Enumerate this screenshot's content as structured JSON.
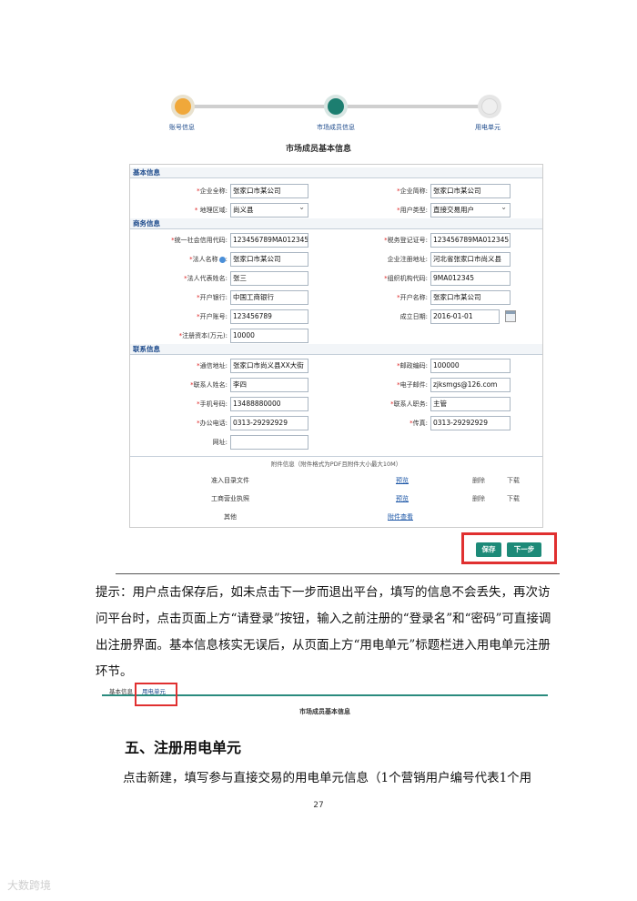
{
  "stepper": {
    "steps": [
      "账号信息",
      "市场成员信息",
      "用电单元"
    ]
  },
  "form": {
    "title": "市场成员基本信息",
    "sections": {
      "basic": "基本信息",
      "business": "商务信息",
      "contact": "联系信息"
    },
    "fields": {
      "company_full_name": {
        "label": "企业全称:",
        "value": "张家口市某公司"
      },
      "company_short_name": {
        "label": "企业简称:",
        "value": "张家口市某公司"
      },
      "region": {
        "label": "地理区域:",
        "value": "尚义县"
      },
      "user_type": {
        "label": "用户类型:",
        "value": "直接交易用户"
      },
      "credit_code": {
        "label": "统一社会信用代码:",
        "value": "123456789MA012345"
      },
      "tax_reg_no": {
        "label": "税务登记证号:",
        "value": "123456789MA012345"
      },
      "legal_name": {
        "label": "法人名称",
        "value": "张家口市某公司"
      },
      "reg_address": {
        "label": "企业注册地址:",
        "value": "河北省张家口市尚义县"
      },
      "legal_rep": {
        "label": "法人代表姓名:",
        "value": "张三"
      },
      "org_code": {
        "label": "组织机构代码:",
        "value": "9MA012345"
      },
      "bank": {
        "label": "开户银行:",
        "value": "中国工商银行"
      },
      "account_name": {
        "label": "开户名称:",
        "value": "张家口市某公司"
      },
      "account_no": {
        "label": "开户账号:",
        "value": "123456789"
      },
      "established": {
        "label": "成立日期:",
        "value": "2016-01-01"
      },
      "reg_capital": {
        "label": "注册资本(万元):",
        "value": "10000"
      },
      "mail_address": {
        "label": "通信地址:",
        "value": "张家口市尚义县XX大街"
      },
      "postcode": {
        "label": "邮政编码:",
        "value": "100000"
      },
      "contact_name": {
        "label": "联系人姓名:",
        "value": "李四"
      },
      "email": {
        "label": "电子邮件:",
        "value": "zjksmgs@126.com"
      },
      "mobile": {
        "label": "手机号码:",
        "value": "13488880000"
      },
      "contact_title": {
        "label": "联系人职务:",
        "value": "主管"
      },
      "office_phone": {
        "label": "办公电话:",
        "value": "0313-29292929"
      },
      "fax": {
        "label": "传真:",
        "value": "0313-29292929"
      },
      "website": {
        "label": "网址:",
        "value": ""
      }
    },
    "attachments": {
      "header": "附件信息（附件格式为PDF且附件大小最大10M）",
      "rows": [
        {
          "name": "准入目录文件",
          "preview": "预览",
          "delete": "删除",
          "download": "下载"
        },
        {
          "name": "工商营业执照",
          "preview": "预览",
          "delete": "删除",
          "download": "下载"
        },
        {
          "name": "其他",
          "view": "附件查看"
        }
      ]
    },
    "buttons": {
      "save": "保存",
      "next": "下一步"
    }
  },
  "tip": "提示：用户点击保存后，如未点击下一步而退出平台，填写的信息不会丢失，再次访问平台时，点击页面上方“请登录”按钮，输入之前注册的“登录名”和“密码”可直接调出注册界面。基本信息核实无误后，从页面上方“用电单元”标题栏进入用电单元注册环节。",
  "mini": {
    "tab_basic": "基本信息",
    "tab_unit": "用电单元",
    "title": "市场成员基本信息"
  },
  "section_heading": "五、注册用电单元",
  "paragraph": "点击新建，填写参与直接交易的用电单元信息（1个营销用户编号代表1个用",
  "page_number": "27",
  "watermark": "大数跨境"
}
